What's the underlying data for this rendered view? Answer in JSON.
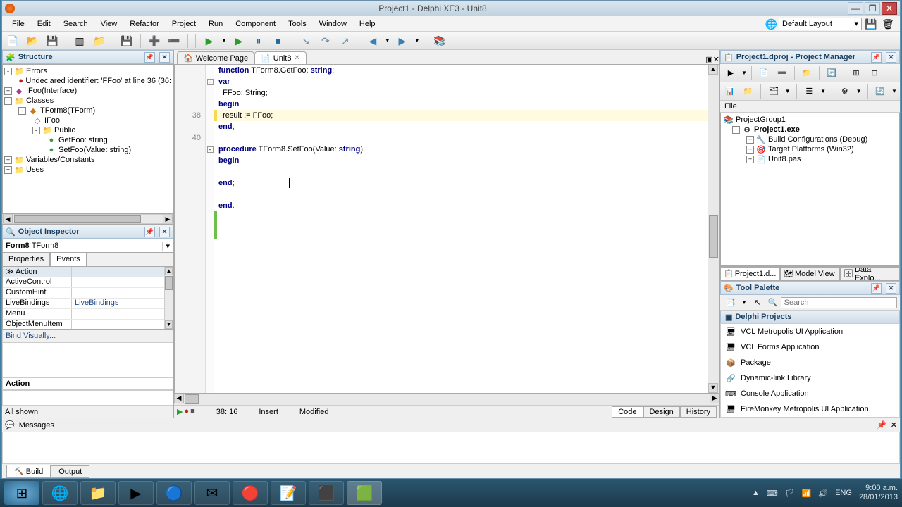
{
  "titlebar": {
    "title": "Project1 - Delphi XE3 - Unit8"
  },
  "menubar": {
    "items": [
      "File",
      "Edit",
      "Search",
      "View",
      "Refactor",
      "Project",
      "Run",
      "Component",
      "Tools",
      "Window",
      "Help"
    ],
    "layout_combo": "Default Layout"
  },
  "structure": {
    "title": "Structure",
    "errors_label": "Errors",
    "error_text": "Undeclared identifier: 'FFoo' at line 36 (36:",
    "ifoo_label": "IFoo(Interface)",
    "classes_label": "Classes",
    "tform8_label": "TForm8(TForm)",
    "ifoo2_label": "IFoo",
    "public_label": "Public",
    "getfoo_label": "GetFoo: string",
    "setfoo_label": "SetFoo(Value: string)",
    "varconst_label": "Variables/Constants",
    "uses_label": "Uses"
  },
  "object_inspector": {
    "title": "Object Inspector",
    "instance_name": "Form8",
    "instance_type": "TForm8",
    "tab_props": "Properties",
    "tab_events": "Events",
    "rows": [
      {
        "k": "Action",
        "v": ""
      },
      {
        "k": "ActiveControl",
        "v": ""
      },
      {
        "k": "CustomHint",
        "v": ""
      },
      {
        "k": "LiveBindings",
        "v": "LiveBindings"
      },
      {
        "k": "Menu",
        "v": ""
      },
      {
        "k": "ObjectMenuItem",
        "v": ""
      }
    ],
    "bind_link": "Bind Visually...",
    "action_label": "Action",
    "all_shown": "All shown"
  },
  "editor": {
    "tabs": {
      "welcome": "Welcome Page",
      "unit": "Unit8"
    },
    "line_labels": {
      "l38": "38",
      "l40": "40"
    },
    "code": {
      "l1_a": "function",
      "l1_b": " TForm8.GetFoo: ",
      "l1_c": "string",
      "l1_d": ";",
      "l2_a": "var",
      "l3_a": "  FFoo: ",
      "l3_b": "String",
      "l3_c": ";",
      "l4_a": "begin",
      "l5_a": "  result := FFoo;",
      "l6_a": "end",
      "l6_b": ";",
      "l7": "",
      "l8_a": "procedure",
      "l8_b": " TForm8.SetFoo(Value: ",
      "l8_c": "string",
      "l8_d": ");",
      "l9_a": "begin",
      "l10": "",
      "l11_a": "end",
      "l11_b": ";",
      "l12": "",
      "l13_a": "end",
      "l13_b": "."
    },
    "status": {
      "pos": "38: 16",
      "mode": "Insert",
      "modified": "Modified"
    },
    "bottom_tabs": {
      "code": "Code",
      "design": "Design",
      "history": "History"
    }
  },
  "project_manager": {
    "title": "Project1.dproj - Project Manager",
    "file_label": "File",
    "projectgroup": "ProjectGroup1",
    "project_exe": "Project1.exe",
    "build_cfg": "Build Configurations (Debug)",
    "targets": "Target Platforms (Win32)",
    "unit8": "Unit8.pas",
    "tabs": {
      "pm": "Project1.d...",
      "model": "Model View",
      "data": "Data Explo..."
    }
  },
  "tool_palette": {
    "title": "Tool Palette",
    "search_placeholder": "Search",
    "category": "Delphi Projects",
    "items": [
      "VCL Metropolis UI Application",
      "VCL Forms Application",
      "Package",
      "Dynamic-link Library",
      "Console Application",
      "FireMonkey Metropolis UI Application"
    ]
  },
  "messages": {
    "title": "Messages",
    "tab_build": "Build",
    "tab_output": "Output"
  },
  "tray": {
    "lang": "ENG",
    "time": "9:00 a.m.",
    "date": "28/01/2013"
  }
}
